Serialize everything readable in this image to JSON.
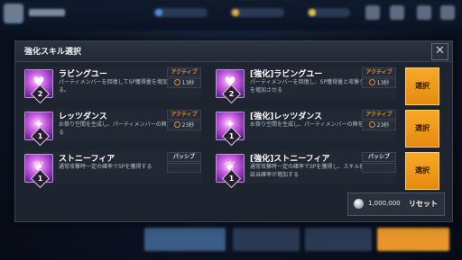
{
  "colors": {
    "accent": "#f29d1e",
    "active_type": "#e58a2e",
    "panel": "#1d2430",
    "icon_glow": "#d065e6"
  },
  "modal": {
    "title": "強化スキル選択",
    "close_icon": "close-icon"
  },
  "rows": [
    {
      "current": {
        "name": "ラビングユー",
        "desc": "パーティメンバーを回復してSP獲得量を増加させる。",
        "type": "アクティブ",
        "cooldown": "13秒",
        "level": "2",
        "icon": "heart-icon"
      },
      "enhanced": {
        "name": "[強化]ラビングユー",
        "desc": "パーティメンバーを回復し、SP獲得量と攻撃ダメージを増加させる",
        "type": "アクティブ",
        "cooldown": "13秒",
        "level": "2",
        "icon": "heart-icon"
      },
      "select_label": "選択"
    },
    {
      "current": {
        "name": "レッツダンス",
        "desc": "お祭り空間を生成し、パーティメンバーの興をそそる",
        "type": "アクティブ",
        "cooldown": "23秒",
        "level": "1",
        "icon": "dance-icon"
      },
      "enhanced": {
        "name": "[強化]レッツダンス",
        "desc": "お祭り空間を生成し、パーティメンバーの興をそそる",
        "type": "アクティブ",
        "cooldown": "23秒",
        "level": "1",
        "icon": "dance-icon"
      },
      "select_label": "選択"
    },
    {
      "current": {
        "name": "ストニーフィア",
        "desc": "通常攻撃時一定の確率でSPを獲得する",
        "type": "パッシブ",
        "level": "1",
        "icon": "stone-icon"
      },
      "enhanced": {
        "name": "[強化]ストニーフィア",
        "desc": "通常攻撃時一定の確率でSPを獲得し、スキル使用時に該当確率が増加する",
        "type": "パッシブ",
        "level": "1",
        "icon": "stone-icon"
      },
      "select_label": "選択"
    }
  ],
  "reset": {
    "cost": "1,000,000",
    "label": "リセット",
    "coin_icon": "coin-icon"
  }
}
